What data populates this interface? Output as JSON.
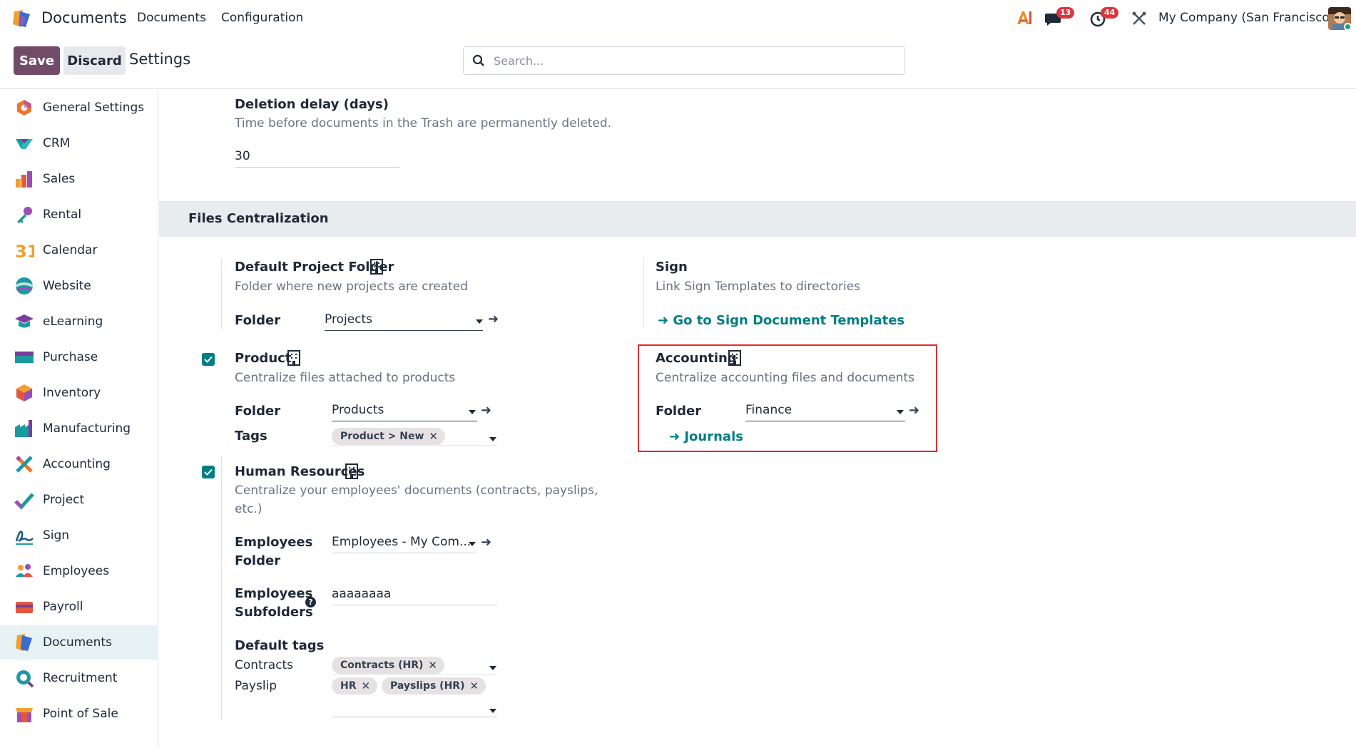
{
  "navbar": {
    "app_name": "Documents",
    "menu": [
      "Documents",
      "Configuration"
    ],
    "messages_count": "13",
    "activities_count": "44",
    "company": "My Company (San Francisco)"
  },
  "control_panel": {
    "save_label": "Save",
    "discard_label": "Discard",
    "title": "Settings",
    "search_placeholder": "Search..."
  },
  "sidebar": {
    "items": [
      {
        "label": "General Settings",
        "icon": "general-settings-icon"
      },
      {
        "label": "CRM",
        "icon": "crm-icon"
      },
      {
        "label": "Sales",
        "icon": "sales-icon"
      },
      {
        "label": "Rental",
        "icon": "rental-icon"
      },
      {
        "label": "Calendar",
        "icon": "calendar-icon"
      },
      {
        "label": "Website",
        "icon": "website-icon"
      },
      {
        "label": "eLearning",
        "icon": "elearning-icon"
      },
      {
        "label": "Purchase",
        "icon": "purchase-icon"
      },
      {
        "label": "Inventory",
        "icon": "inventory-icon"
      },
      {
        "label": "Manufacturing",
        "icon": "manufacturing-icon"
      },
      {
        "label": "Accounting",
        "icon": "accounting-icon"
      },
      {
        "label": "Project",
        "icon": "project-icon"
      },
      {
        "label": "Sign",
        "icon": "sign-icon"
      },
      {
        "label": "Employees",
        "icon": "employees-icon"
      },
      {
        "label": "Payroll",
        "icon": "payroll-icon"
      },
      {
        "label": "Documents",
        "icon": "documents-icon",
        "active": true
      },
      {
        "label": "Recruitment",
        "icon": "recruitment-icon"
      },
      {
        "label": "Point of Sale",
        "icon": "point-of-sale-icon"
      }
    ],
    "calendar_number": "31"
  },
  "deletion": {
    "title": "Deletion delay (days)",
    "description": "Time before documents in the Trash are permanently deleted.",
    "value": "30"
  },
  "files_centralization": {
    "section_title": "Files Centralization",
    "project": {
      "title": "Default Project Folder",
      "description": "Folder where new projects are created",
      "folder_label": "Folder",
      "folder_value": "Projects"
    },
    "sign": {
      "title": "Sign",
      "description": "Link Sign Templates to directories",
      "link": "Go to Sign Document Templates"
    },
    "product": {
      "checked": true,
      "title": "Product",
      "description": "Centralize files attached to products",
      "folder_label": "Folder",
      "folder_value": "Products",
      "tags_label": "Tags",
      "tags": [
        "Product > New"
      ]
    },
    "accounting": {
      "title": "Accounting",
      "description": "Centralize accounting files and documents",
      "folder_label": "Folder",
      "folder_value": "Finance",
      "link": "Journals"
    },
    "hr": {
      "checked": true,
      "title": "Human Resources",
      "description_line1": "Centralize your employees' documents (contracts, payslips,",
      "description_line2": "etc.)",
      "employees_folder_label_1": "Employees",
      "employees_folder_label_2": "Folder",
      "employees_folder_value": "Employees - My Com...",
      "employees_subfolders_label_1": "Employees",
      "employees_subfolders_label_2": "Subfolders",
      "employees_subfolders_value": "aaaaaaaa",
      "default_tags_label": "Default tags",
      "contracts_label": "Contracts",
      "contracts_tags": [
        "Contracts (HR)"
      ],
      "payslip_label": "Payslip",
      "payslip_tags": [
        "HR",
        "Payslips (HR)"
      ]
    }
  },
  "colors": {
    "primary": "#714b67",
    "link": "#017e84",
    "highlight_border": "#e32b2b",
    "badge": "#d9363e"
  }
}
